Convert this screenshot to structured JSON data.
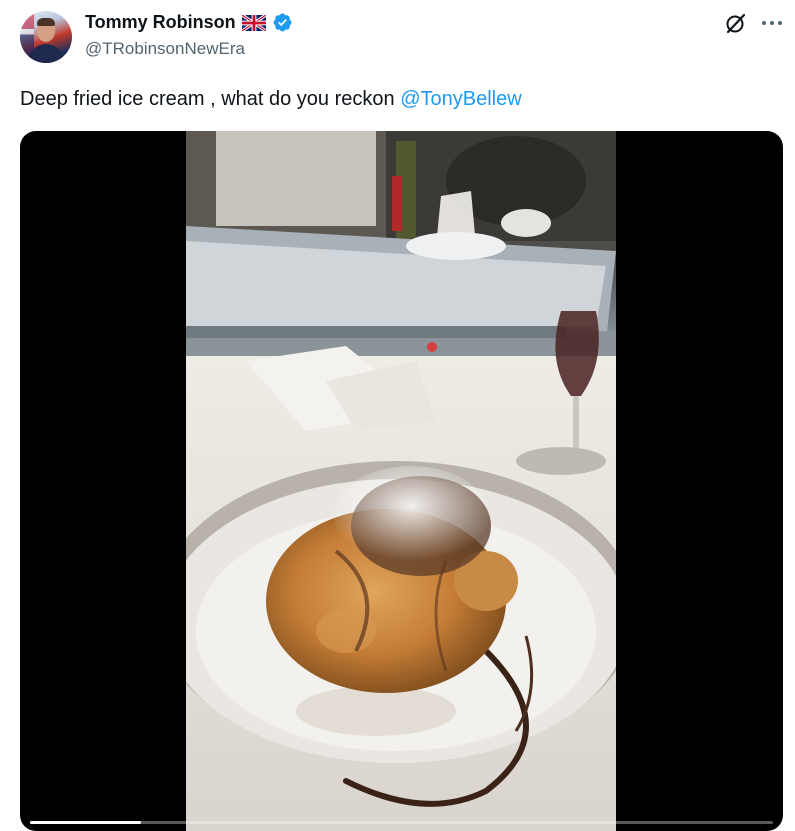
{
  "author": {
    "display_name": "Tommy Robinson",
    "handle": "@TRobinsonNewEra",
    "flag_icon": "uk-flag-icon",
    "verified_icon": "verified-badge-icon",
    "verified_color": "#1d9bf0"
  },
  "actions": {
    "grok_icon": "grok-icon",
    "more_icon": "more-options-icon"
  },
  "tweet": {
    "text": "Deep fried ice cream , what do you reckon ",
    "mention": "@TonyBellew",
    "mention_color": "#1d9bf0"
  },
  "media": {
    "type": "video",
    "progress": 0.15
  }
}
